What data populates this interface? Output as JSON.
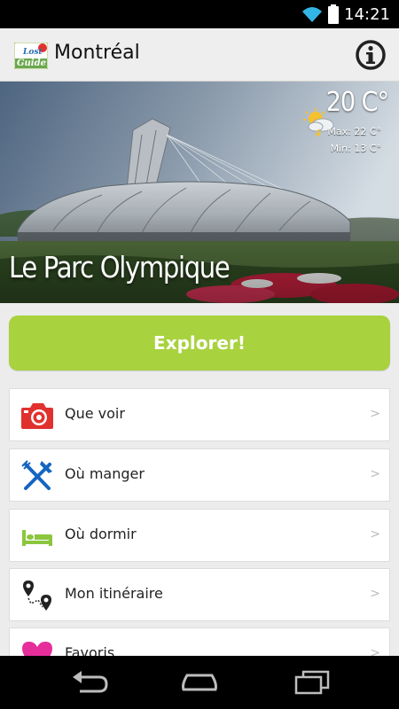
{
  "status_bar": {
    "time": "14:21"
  },
  "action_bar": {
    "logo_text_top": "Lost",
    "logo_text_bottom": "Guide",
    "title": "Montréal"
  },
  "hero": {
    "title": "Le Parc Olympique"
  },
  "weather": {
    "temperature": "20 C°",
    "max": "Max: 22 C°",
    "min": "Min: 13 C°"
  },
  "explore_button": {
    "label": "Explorer!"
  },
  "menu": {
    "chevron": ">",
    "items": [
      {
        "label": "Que voir",
        "icon": "camera-icon"
      },
      {
        "label": "Où manger",
        "icon": "fork-knife-icon"
      },
      {
        "label": "Où dormir",
        "icon": "bed-icon"
      },
      {
        "label": "Mon itinéraire",
        "icon": "route-icon"
      },
      {
        "label": "Favoris",
        "icon": "heart-icon"
      }
    ]
  },
  "colors": {
    "accent_green": "#a8d23e",
    "icon_red": "#e0312f",
    "icon_blue": "#1565c0",
    "icon_green": "#8cc63f",
    "icon_magenta": "#e62e9b"
  }
}
